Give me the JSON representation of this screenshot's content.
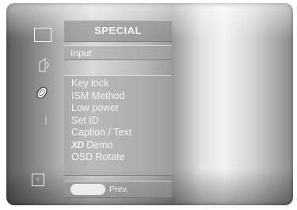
{
  "title": "SPECIAL",
  "input_label": "Input",
  "menu_items": [
    "Key lock",
    "ISM Method",
    "Low power",
    "Set ID",
    "Caption / Text"
  ],
  "xd_logo": "XD",
  "xd_item_label": "Demo",
  "osd_rotate_label": "OSD Rotate",
  "footer": {
    "prev_label": "Prev."
  },
  "side_icons": [
    "picture-icon",
    "sound-icon",
    "time-icon",
    "special-icon",
    "screen-icon"
  ],
  "screen_icon_glyph": "♀"
}
